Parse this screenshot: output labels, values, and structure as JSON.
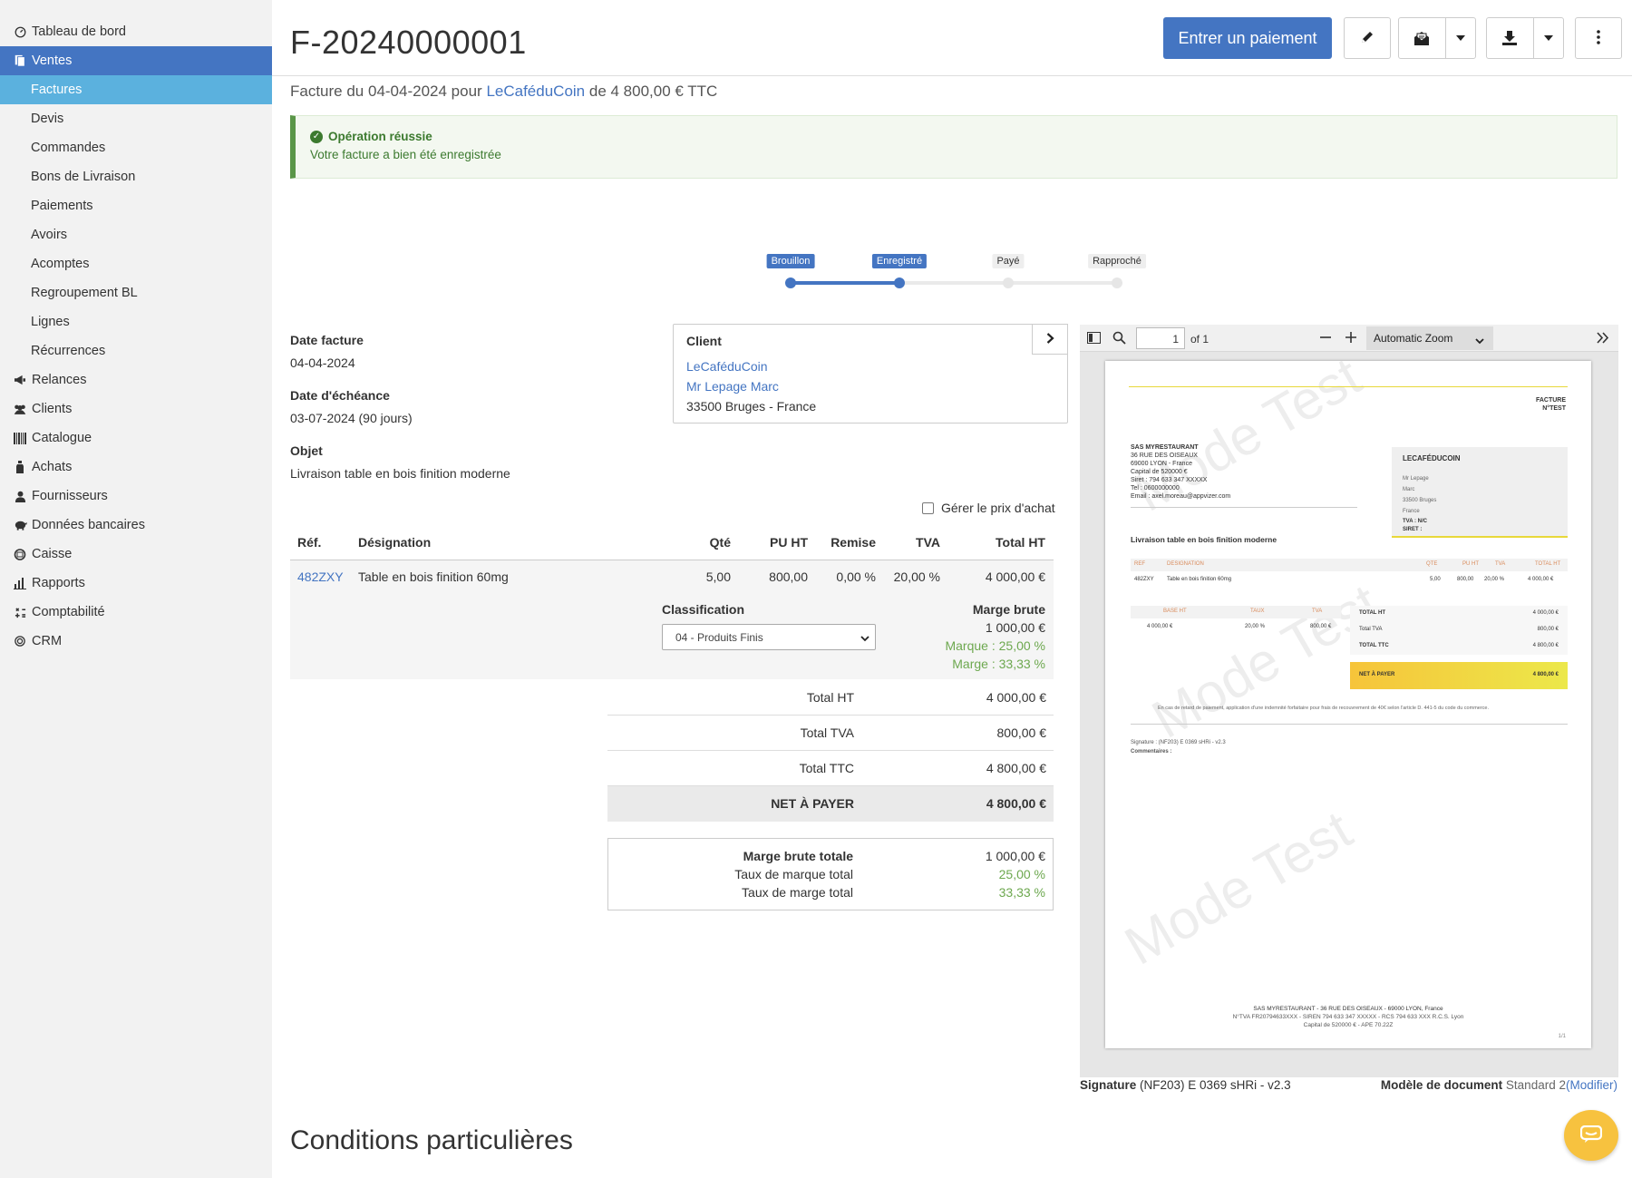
{
  "sidebar": {
    "items": [
      {
        "label": "Tableau de bord",
        "icon": "dashboard-icon",
        "type": "top",
        "active": false
      },
      {
        "label": "Ventes",
        "icon": "sales-icon",
        "type": "top",
        "active": true
      },
      {
        "label": "Factures",
        "type": "sub",
        "active": true
      },
      {
        "label": "Devis",
        "type": "sub",
        "active": false
      },
      {
        "label": "Commandes",
        "type": "sub",
        "active": false
      },
      {
        "label": "Bons de Livraison",
        "type": "sub",
        "active": false
      },
      {
        "label": "Paiements",
        "type": "sub",
        "active": false
      },
      {
        "label": "Avoirs",
        "type": "sub",
        "active": false
      },
      {
        "label": "Acomptes",
        "type": "sub",
        "active": false
      },
      {
        "label": "Regroupement BL",
        "type": "sub",
        "active": false
      },
      {
        "label": "Lignes",
        "type": "sub",
        "active": false
      },
      {
        "label": "Récurrences",
        "type": "sub",
        "active": false
      },
      {
        "label": "Relances",
        "icon": "megaphone-icon",
        "type": "top",
        "active": false
      },
      {
        "label": "Clients",
        "icon": "users-icon",
        "type": "top",
        "active": false
      },
      {
        "label": "Catalogue",
        "icon": "barcode-icon",
        "type": "top",
        "active": false
      },
      {
        "label": "Achats",
        "icon": "bottle-icon",
        "type": "top",
        "active": false
      },
      {
        "label": "Fournisseurs",
        "icon": "user-icon",
        "type": "top",
        "active": false
      },
      {
        "label": "Données bancaires",
        "icon": "piggy-bank-icon",
        "type": "top",
        "active": false
      },
      {
        "label": "Caisse",
        "icon": "cash-register-icon",
        "type": "top",
        "active": false
      },
      {
        "label": "Rapports",
        "icon": "bar-chart-icon",
        "type": "top",
        "active": false
      },
      {
        "label": "Comptabilité",
        "icon": "calculator-icon",
        "type": "top",
        "active": false
      },
      {
        "label": "CRM",
        "icon": "target-icon",
        "type": "top",
        "active": false
      }
    ]
  },
  "header": {
    "title": "F-20240000001",
    "pay_button": "Entrer un paiement",
    "edit_icon": "pencil-icon",
    "email_icon": "envelope-open-icon",
    "download_icon": "download-icon",
    "more_icon": "kebab-menu-icon"
  },
  "subtitle": {
    "prefix": "Facture du 04-04-2024 pour",
    "client_link": "LeCaféduCoin",
    "suffix": "de 4 800,00 € TTC"
  },
  "alert": {
    "title": "Opération réussie",
    "message": "Votre facture a bien été enregistrée",
    "color": "#5a9648"
  },
  "status_steps": [
    {
      "label": "Brouillon",
      "done": true
    },
    {
      "label": "Enregistré",
      "done": true
    },
    {
      "label": "Payé",
      "done": false
    },
    {
      "label": "Rapproché",
      "done": false
    }
  ],
  "invoice": {
    "date_label": "Date facture",
    "date_value": "04-04-2024",
    "due_label": "Date d'échéance",
    "due_value": "03-07-2024 (90 jours)",
    "object_label": "Objet",
    "object_value": "Livraison table en bois finition moderne"
  },
  "client": {
    "title": "Client",
    "name": "LeCaféduCoin",
    "contact": "Mr Lepage Marc",
    "address": "33500 Bruges - France"
  },
  "purchase_price_checkbox": "Gérer le prix d'achat",
  "table": {
    "headers": {
      "ref": "Réf.",
      "designation": "Désignation",
      "qty": "Qté",
      "pu": "PU HT",
      "remise": "Remise",
      "tva": "TVA",
      "total": "Total HT"
    },
    "row": {
      "ref": "482ZXY",
      "designation": "Table en bois finition 60mg",
      "qty": "5,00",
      "pu": "800,00",
      "remise": "0,00 %",
      "tva": "20,00 %",
      "total": "4 000,00 €"
    },
    "classification_label": "Classification",
    "classification_value": "04 - Produits Finis",
    "marge_label": "Marge brute",
    "marge_value": "1 000,00 €",
    "marque_rate": "Marque : 25,00 %",
    "marge_rate": "Marge : 33,33 %"
  },
  "totals": [
    {
      "label": "Total HT",
      "value": "4 000,00 €"
    },
    {
      "label": "Total TVA",
      "value": "800,00 €"
    },
    {
      "label": "Total TTC",
      "value": "4 800,00 €"
    },
    {
      "label": "NET À PAYER",
      "value": "4 800,00 €"
    }
  ],
  "marge_totals": [
    {
      "label": "Marge brute totale",
      "value": "1 000,00 €"
    },
    {
      "label": "Taux de marque total",
      "value": "25,00 %"
    },
    {
      "label": "Taux de marge total",
      "value": "33,33 %"
    }
  ],
  "pdf": {
    "page_value": "1",
    "page_of": "of 1",
    "zoom": "Automatic Zoom",
    "doc": {
      "heading1": "FACTURE",
      "heading2": "N°TEST",
      "sender": [
        "SAS MYRESTAURANT",
        "36 RUE DES OISEAUX",
        "69000 LYON - France",
        "Capital de 520000 €",
        "Siret : 794 633 347 XXXXX",
        "Tel : 0600000000",
        "Email : axel.moreau@appvizer.com"
      ],
      "recipient_name": "LECAFÉDUCOIN",
      "recipient": [
        "Mr Lepage",
        "Marc",
        "",
        "33500 Bruges",
        "France",
        "TVA : N/C",
        "SIRET :"
      ],
      "object": "Livraison table en bois finition moderne",
      "cols": [
        "REF",
        "DESIGNATION",
        "QTE",
        "PU HT",
        "TVA",
        "TOTAL HT"
      ],
      "line": [
        "482ZXY",
        "Table en bois finition 60mg",
        "5,00",
        "800,00",
        "20,00 %",
        "4 000,00 €"
      ],
      "vat_cols": [
        "BASE HT",
        "TAUX",
        "TVA"
      ],
      "vat_line": [
        "4 000,00 €",
        "20,00 %",
        "800,00 €"
      ],
      "totals": [
        [
          "TOTAL HT",
          "4 000,00 €"
        ],
        [
          "Total TVA",
          "800,00 €"
        ],
        [
          "TOTAL TTC",
          "4 800,00 €"
        ]
      ],
      "net_label": "NET À PAYER",
      "net_value": "4 800,00 €",
      "late_notice": "En cas de retard de paiement, application d'une indemnité forfaitaire pour frais de recouvrement de 40€ selon l'article D. 441-5 du code du commerce.",
      "signature": "Signature : (NF203) E 0369 sHRi - v2.3",
      "comments": "Commentaires :",
      "footer1": "SAS MYRESTAURANT - 36 RUE DES OISEAUX - 69000 LYON, France",
      "footer2": "N°TVA FR20794633XXX - SIREN 794 633 347 XXXXX - RCS 794 633 XXX R.C.S. Lyon",
      "footer3": "Capital de 520000 € - APE 70.22Z",
      "page_num": "1/1",
      "watermark": "Mode Test"
    }
  },
  "pdf_footer": {
    "signature_label": "Signature",
    "signature_value": "(NF203) E 0369 sHRi - v2.3",
    "model_label": "Modèle de document",
    "model_value": "Standard 2",
    "model_link": "(Modifier)"
  },
  "conditions_title": "Conditions particulières",
  "colors": {
    "primary": "#4475c2",
    "sub_active": "#5bb1de",
    "success": "#5a9648",
    "margin_green": "#6da84f",
    "chat": "#f7c23f"
  }
}
